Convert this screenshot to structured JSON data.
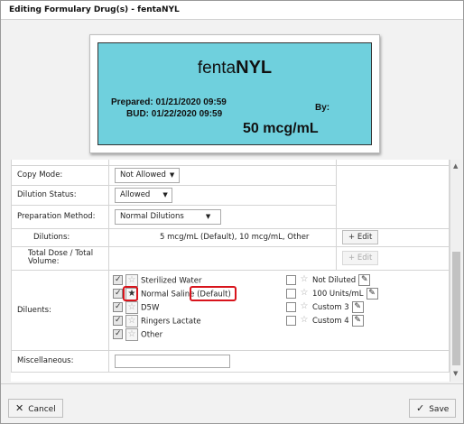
{
  "dialog": {
    "title": "Editing Formulary Drug(s) - fentaNYL"
  },
  "label_preview": {
    "drug_name_lower": "fenta",
    "drug_name_upper": "NYL",
    "prepared": "Prepared: 01/21/2020 09:59",
    "bud": "BUD: 01/22/2020 09:59",
    "by": "By:",
    "concentration": "50 mcg/mL",
    "background_color": "#6fd0dd"
  },
  "form": {
    "copy_mode": {
      "label": "Copy Mode:",
      "value": "Not Allowed"
    },
    "dilution_status": {
      "label": "Dilution Status:",
      "value": "Allowed"
    },
    "preparation_method": {
      "label": "Preparation Method:",
      "value": "Normal Dilutions"
    },
    "dilutions": {
      "label": "Dilutions:",
      "value": "5 mcg/mL (Default), 10 mcg/mL, Other",
      "edit_label": "+ Edit"
    },
    "total_dose": {
      "label": "Total Dose / Total Volume:",
      "edit_label": "+ Edit"
    },
    "diluents": {
      "label": "Diluents:",
      "left": [
        {
          "name": "Sterilized Water",
          "checked": true,
          "star_filled": false
        },
        {
          "name": "Normal Saline",
          "checked": true,
          "star_filled": true,
          "suffix": "(Default)"
        },
        {
          "name": "D5W",
          "checked": true,
          "star_filled": false
        },
        {
          "name": "Ringers Lactate",
          "checked": true,
          "star_filled": false
        },
        {
          "name": "Other",
          "checked": true,
          "star_filled": false
        }
      ],
      "right": [
        {
          "name": "Not Diluted",
          "checked": false
        },
        {
          "name": "100 Units/mL",
          "checked": false
        },
        {
          "name": "Custom 3",
          "checked": false
        },
        {
          "name": "Custom 4",
          "checked": false
        }
      ]
    },
    "miscellaneous": {
      "label": "Miscellaneous:",
      "value": ""
    }
  },
  "footer": {
    "cancel_label": "Cancel",
    "save_label": "Save"
  },
  "colors": {
    "highlight": "#d8141c"
  }
}
